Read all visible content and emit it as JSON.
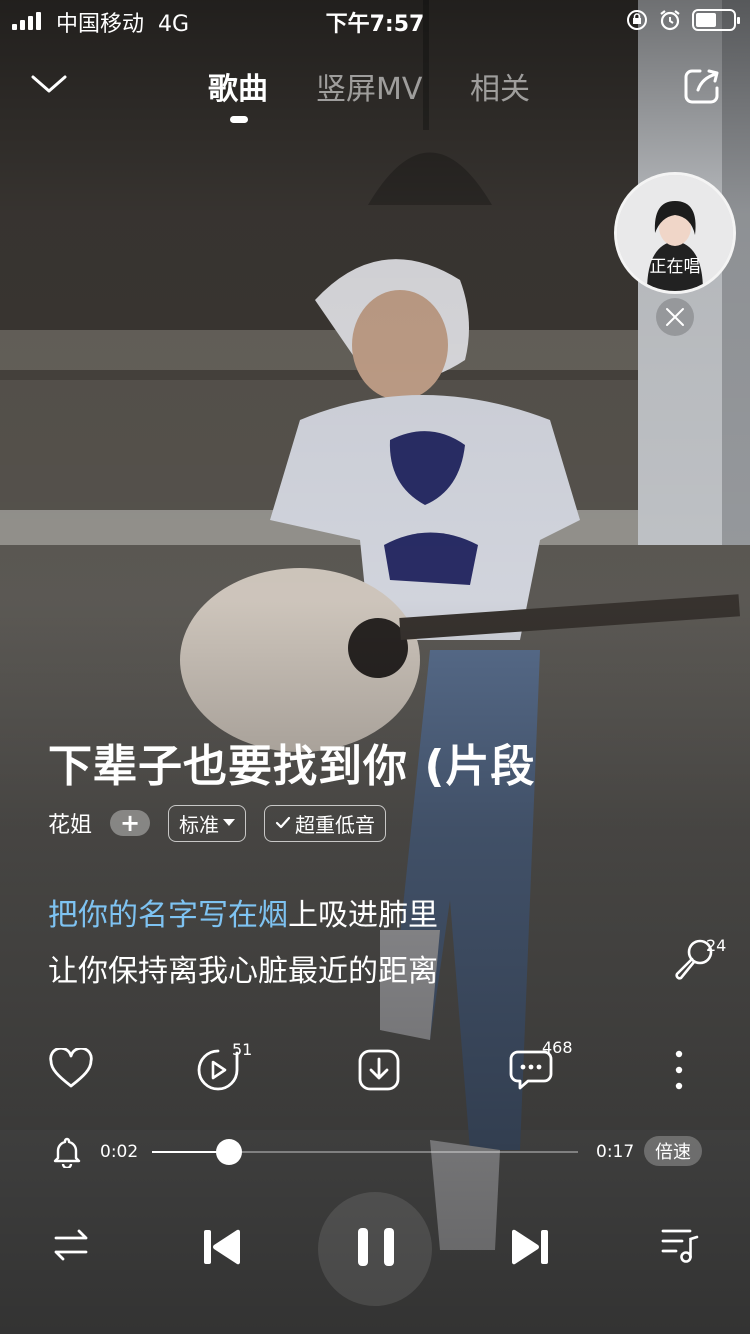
{
  "status_bar": {
    "carrier": "中国移动",
    "network": "4G",
    "time": "下午7:57"
  },
  "nav": {
    "tabs": [
      {
        "label": "歌曲",
        "active": true
      },
      {
        "label": "竖屏MV",
        "active": false
      },
      {
        "label": "相关",
        "active": false
      }
    ]
  },
  "floating_singer": {
    "label": "正在唱"
  },
  "song": {
    "title": "下辈子也要找到你 (片段",
    "artist": "花姐",
    "quality": "标准",
    "effect": "超重低音"
  },
  "lyrics": {
    "current_sung": "把你的名字写在烟",
    "current_rest": "上吸进肺里",
    "next": "让你保持离我心脏最近的距离"
  },
  "counts": {
    "karaoke": "24",
    "video": "51",
    "comments": "468"
  },
  "player": {
    "elapsed": "0:02",
    "duration": "0:17",
    "progress": 0.18,
    "speed_label": "倍速"
  },
  "colors": {
    "lyric_highlight": "#7ec3f2",
    "foreground": "#ffffff"
  },
  "icons": [
    "chevron-down-icon",
    "share-icon",
    "close-icon",
    "plus-icon",
    "dropdown-arrow-icon",
    "check-icon",
    "microphone-icon",
    "heart-icon",
    "video-icon",
    "download-icon",
    "comment-icon",
    "more-icon",
    "bell-icon",
    "shuffle-icon",
    "previous-icon",
    "pause-icon",
    "next-icon",
    "playlist-icon"
  ]
}
